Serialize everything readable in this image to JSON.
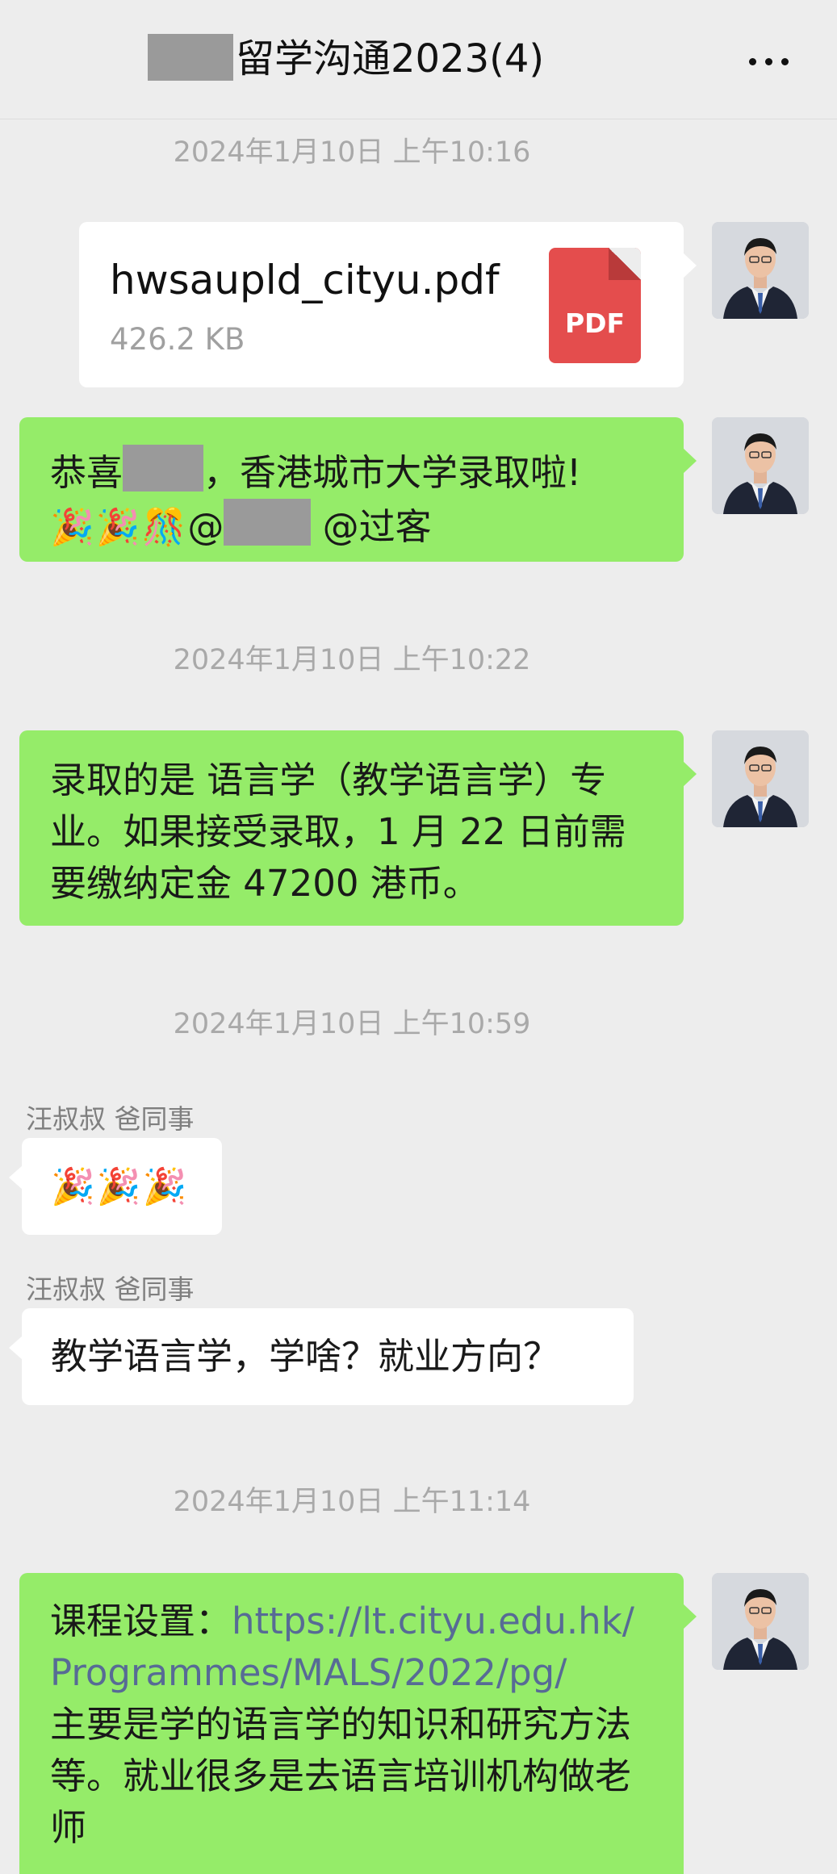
{
  "header": {
    "title": "留学沟通2023(4)",
    "more_icon": "more-icon"
  },
  "messages": {
    "ts1": "2024年1月10日 上午10:16",
    "file": {
      "name": "hwsaupld_cityu.pdf",
      "size": "426.2 KB",
      "badge": "PDF"
    },
    "congrats": {
      "part1": "恭喜",
      "part2": "，香港城市大学录取啦!",
      "emoji": "🎉🎉🎊",
      "at1": "@",
      "at2": "@过客"
    },
    "ts2": "2024年1月10日 上午10:22",
    "admission": "录取的是 语言学（教学语言学）专业。如果接受录取，1 月 22 日前需要缴纳定金 47200 港币。",
    "ts3": "2024年1月10日 上午10:59",
    "sender1": "汪叔叔 爸同事",
    "emoji_msg": "🎉🎉🎉",
    "sender2": "汪叔叔 爸同事",
    "question": "教学语言学，学啥？就业方向？",
    "ts4": "2024年1月10日 上午11:14",
    "course": {
      "label": "课程设置：",
      "link_line1": "https://lt.cityu.edu.hk/",
      "link_line2": "Programmes/MALS/2022/pg/",
      "text": "主要是学的语言学的知识和研究方法等。就业很多是去语言培训机构做老师"
    }
  },
  "colors": {
    "background": "#ededed",
    "green_bubble": "#95ec69",
    "link": "#576b95",
    "pdf": "#e44d4d"
  }
}
